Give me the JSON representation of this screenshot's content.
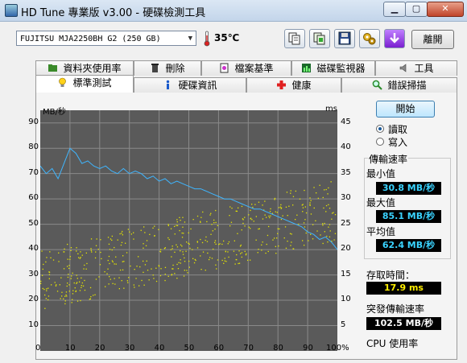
{
  "window": {
    "title": "HD Tune 專業版 v3.00 - 硬碟檢測工具",
    "min_glyph": "▁",
    "max_glyph": "▢",
    "close_glyph": "✕"
  },
  "toolbar": {
    "drive": "FUJITSU MJA2250BH G2 (250 GB)",
    "temperature": "35",
    "temp_unit": "℃",
    "exit_label": "離開"
  },
  "tabs_top": [
    {
      "label": "資料夾使用率",
      "icon": "folder-icon"
    },
    {
      "label": "刪除",
      "icon": "trash-icon"
    },
    {
      "label": "檔案基準",
      "icon": "file-benchmark-icon"
    },
    {
      "label": "磁碟監視器",
      "icon": "monitor-icon"
    },
    {
      "label": "工具",
      "icon": "speaker-icon"
    }
  ],
  "tabs_bottom": [
    {
      "label": "標準測試",
      "icon": "bulb-icon",
      "active": true
    },
    {
      "label": "硬碟資訊",
      "icon": "info-icon"
    },
    {
      "label": "健康",
      "icon": "health-cross-icon"
    },
    {
      "label": "錯誤掃描",
      "icon": "magnifier-icon"
    }
  ],
  "chart": {
    "left_unit": "MB/秒",
    "right_unit": "ms",
    "left_ticks": [
      "90",
      "80",
      "70",
      "60",
      "50",
      "40",
      "30",
      "20",
      "10"
    ],
    "right_ticks": [
      "45",
      "40",
      "35",
      "30",
      "25",
      "20",
      "15",
      "10",
      "5"
    ],
    "x_ticks": [
      "0",
      "10",
      "20",
      "30",
      "40",
      "50",
      "60",
      "70",
      "80",
      "90",
      "100%"
    ]
  },
  "chart_data": {
    "type": "line",
    "x_range": [
      0,
      100
    ],
    "ylim": [
      0,
      90
    ],
    "y2lim": [
      0,
      45
    ],
    "grid": true,
    "series": [
      {
        "color": "#3fb6ff",
        "x": [
          0,
          2,
          4,
          6,
          8,
          10,
          12,
          14,
          16,
          18,
          20,
          22,
          24,
          26,
          28,
          30,
          32,
          34,
          36,
          38,
          40,
          42,
          44,
          46,
          48,
          50,
          52,
          54,
          56,
          58,
          60,
          62,
          64,
          66,
          68,
          70,
          72,
          74,
          76,
          78,
          80,
          82,
          84,
          86,
          88,
          90,
          92,
          94,
          96,
          98,
          100
        ],
        "values": [
          73,
          70,
          72,
          68,
          74,
          80,
          78,
          74,
          75,
          73,
          72,
          73,
          71,
          70,
          72,
          70,
          71,
          70,
          68,
          69,
          67,
          68,
          66,
          67,
          66,
          65,
          64,
          64,
          63,
          62,
          61,
          60,
          60,
          59,
          58,
          57,
          56,
          56,
          55,
          54,
          53,
          52,
          51,
          50,
          49,
          47,
          46,
          44,
          45,
          43,
          40
        ]
      },
      {
        "color": "#e6e600",
        "kind": "scatter",
        "description_x": [
          0,
          100
        ],
        "values_range_ms": [
          6,
          30
        ]
      }
    ]
  },
  "side": {
    "start_label": "開始",
    "read_label": "讀取",
    "write_label": "寫入",
    "transfer_title": "傳輸速率",
    "min_label": "最小值",
    "min_value": "30.8 MB/秒",
    "max_label": "最大值",
    "max_value": "85.1 MB/秒",
    "avg_label": "平均值",
    "avg_value": "62.4 MB/秒",
    "access_label": "存取時間：",
    "access_value": "17.9 ms",
    "burst_label": "突發傳輸速率",
    "burst_value": "102.5 MB/秒",
    "cpu_label": "CPU 使用率"
  },
  "colors": {
    "chart_bg": "#5a5a5a",
    "grid": "#8a8a8a",
    "transfer_line": "#3fb6ff",
    "access_dots": "#e6e600"
  }
}
